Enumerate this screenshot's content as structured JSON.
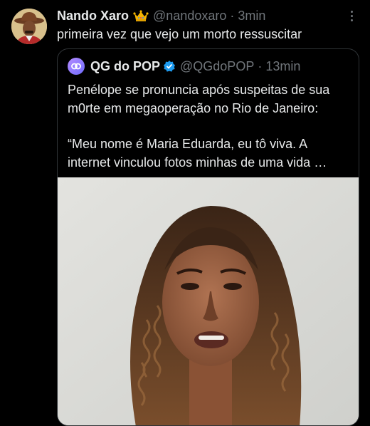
{
  "tweet": {
    "display_name": "Nando Xaro",
    "crown_emoji": "crown-icon",
    "handle": "@nandoxaro",
    "separator": "·",
    "time": "3min",
    "text": "primeira vez que vejo um morto ressuscitar"
  },
  "quote": {
    "display_name": "QG do POP",
    "handle": "@QGdoPOP",
    "separator": "·",
    "time": "13min",
    "lines": [
      "Penélope se pronuncia após suspeitas de sua",
      "m0rte em megaoperação no Rio de Janeiro:",
      "“Meu nome é Maria Eduarda, eu tô viva. A",
      "internet vinculou fotos minhas de uma vida …"
    ]
  },
  "colors": {
    "background": "#000000",
    "text_primary": "#e7e9ea",
    "text_secondary": "#71767b",
    "border": "#2f3336",
    "verified": "#1d9bf0"
  }
}
